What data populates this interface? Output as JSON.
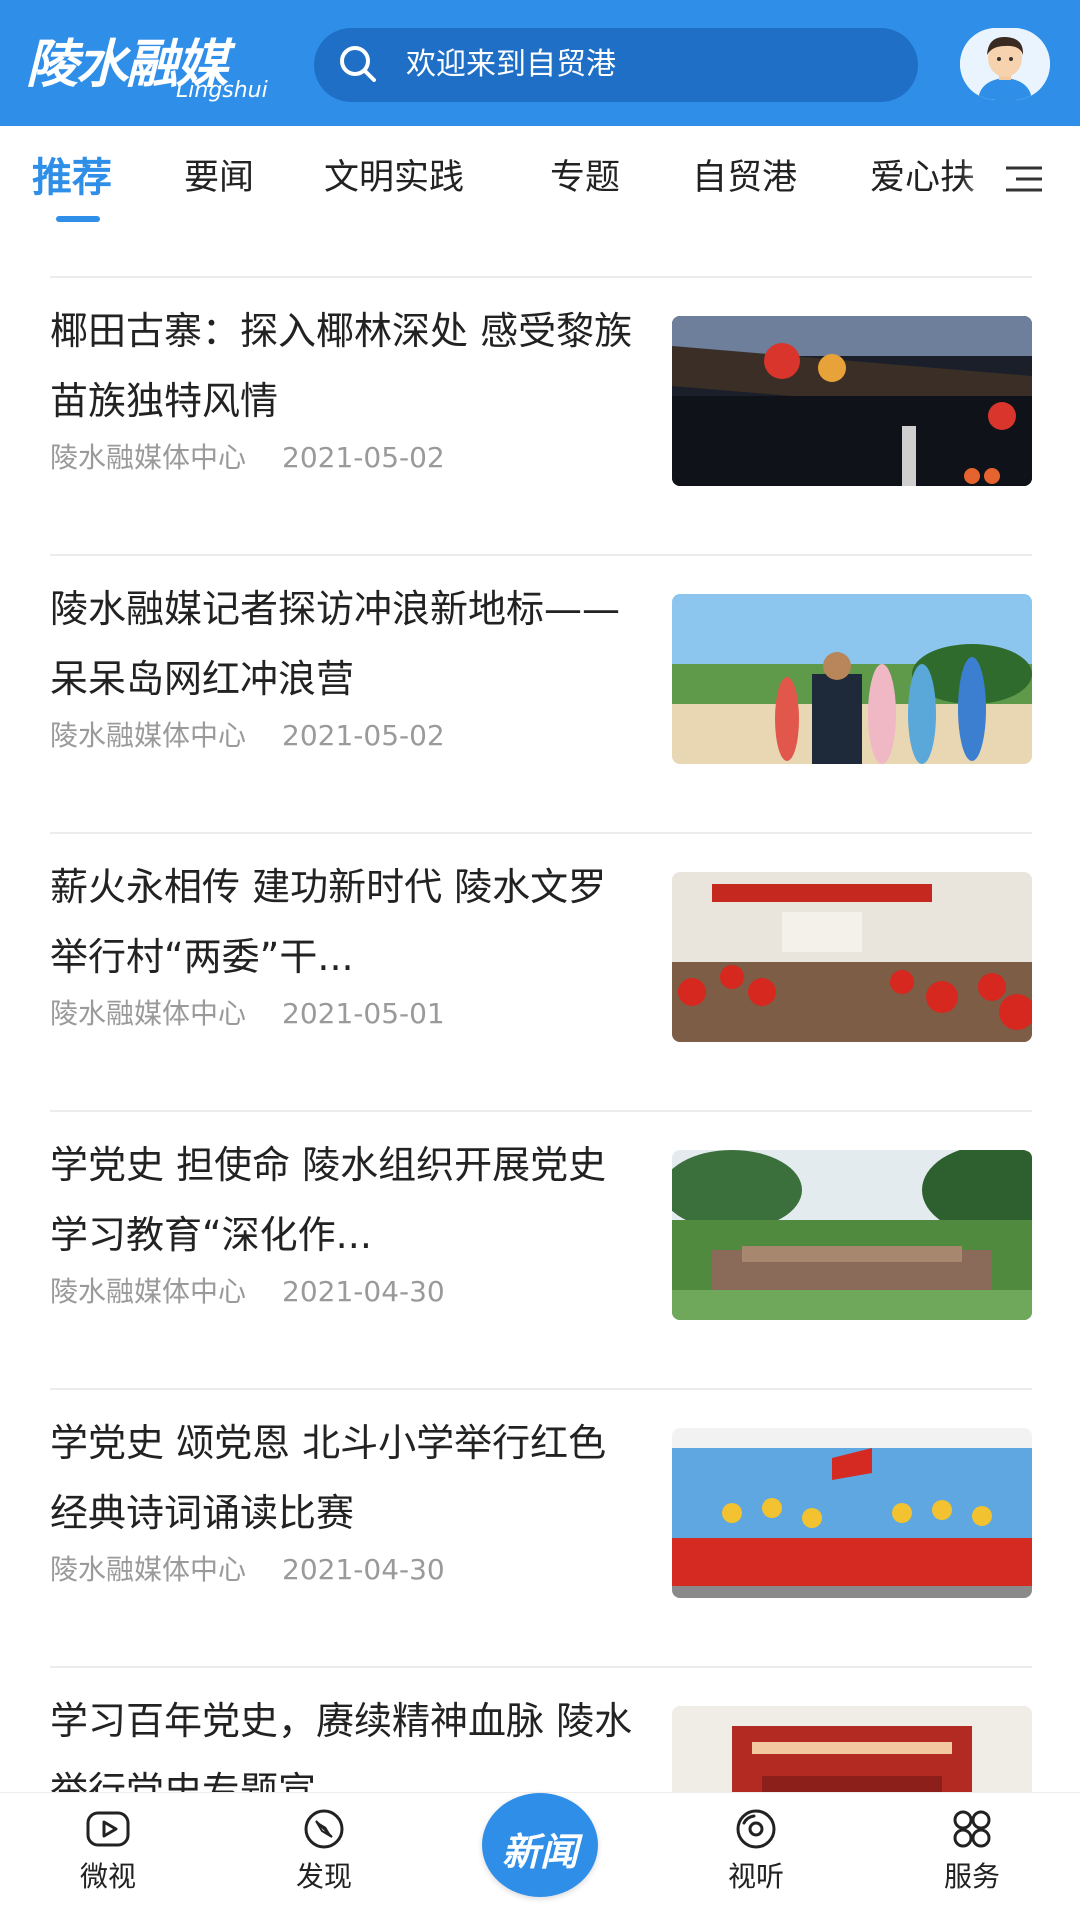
{
  "header": {
    "logo_text": "陵水融媒",
    "logo_subtext": "Lingshui",
    "search_placeholder": "欢迎来到自贸港",
    "avatar_icon": "user-avatar-icon"
  },
  "tabs": [
    {
      "label": "推荐",
      "active": true
    },
    {
      "label": "要闻",
      "active": false
    },
    {
      "label": "文明实践",
      "active": false
    },
    {
      "label": "专题",
      "active": false
    },
    {
      "label": "自贸港",
      "active": false
    },
    {
      "label": "爱心扶",
      "active": false
    }
  ],
  "articles": [
    {
      "title": "椰田古寨：探入椰林深处 感受黎族苗族独特风情",
      "source": "陵水融媒体中心",
      "date": "2021-05-02"
    },
    {
      "title": "陵水融媒记者探访冲浪新地标——呆呆岛网红冲浪营",
      "source": "陵水融媒体中心",
      "date": "2021-05-02"
    },
    {
      "title": "薪火永相传 建功新时代 陵水文罗举行村“两委”干...",
      "source": "陵水融媒体中心",
      "date": "2021-05-01"
    },
    {
      "title": "学党史 担使命 陵水组织开展党史学习教育“深化作...",
      "source": "陵水融媒体中心",
      "date": "2021-04-30"
    },
    {
      "title": "学党史 颂党恩 北斗小学举行红色经典诗词诵读比赛",
      "source": "陵水融媒体中心",
      "date": "2021-04-30"
    },
    {
      "title": "学习百年党史，赓续精神血脉 陵水举行党史专题宣",
      "source": "",
      "date": ""
    }
  ],
  "bottom_nav": [
    {
      "label": "微视",
      "icon": "play-video-icon"
    },
    {
      "label": "发现",
      "icon": "compass-icon"
    },
    {
      "label": "新闻",
      "icon": "news-center-icon"
    },
    {
      "label": "视听",
      "icon": "disc-icon"
    },
    {
      "label": "服务",
      "icon": "grid-services-icon"
    }
  ],
  "colors": {
    "brand": "#2f8fe8",
    "search_bg": "#1f6fc6",
    "meta_text": "#9a9a9a"
  }
}
